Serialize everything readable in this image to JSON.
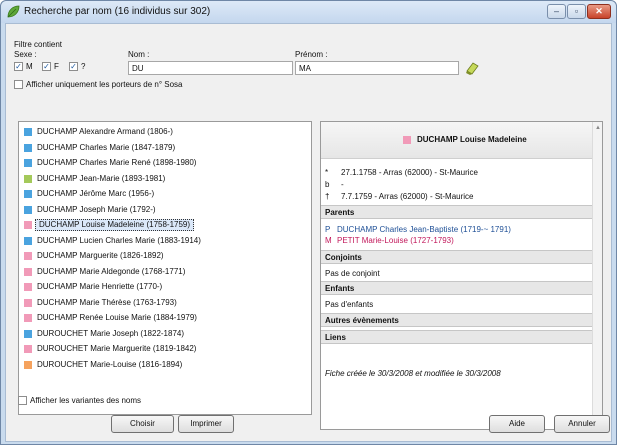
{
  "window": {
    "title": "Recherche par nom (16 individus sur 302)",
    "buttons": {
      "minimize": "‒",
      "maximize": "▫",
      "close": "✕"
    }
  },
  "filter": {
    "group_label": "Filtre contient",
    "sex_label": "Sexe :",
    "sex_options": [
      {
        "label": "M",
        "checked": true
      },
      {
        "label": "F",
        "checked": true
      },
      {
        "label": "?",
        "checked": true
      }
    ],
    "nom_label": "Nom :",
    "nom_value": "DU",
    "prenom_label": "Prénom :",
    "prenom_value": "MA",
    "sosa_label": "Afficher uniquement les porteurs de n° Sosa",
    "sosa_checked": false,
    "clear_icon": "eraser-icon"
  },
  "list": {
    "items": [
      {
        "label": "DUCHAMP Alexandre Armand (1806-)",
        "color": "#4aa3df"
      },
      {
        "label": "DUCHAMP Charles Marie (1847-1879)",
        "color": "#4aa3df"
      },
      {
        "label": "DUCHAMP Charles Marie René (1898-1980)",
        "color": "#4aa3df"
      },
      {
        "label": "DUCHAMP Jean-Marie (1893-1981)",
        "color": "#a4c95a"
      },
      {
        "label": "DUCHAMP Jérôme Marc (1956-)",
        "color": "#4aa3df"
      },
      {
        "label": "DUCHAMP Joseph Marie (1792-)",
        "color": "#4aa3df"
      },
      {
        "label": "DUCHAMP Louise Madeleine (1758-1759)",
        "color": "#f19ab8",
        "selected": true
      },
      {
        "label": "DUCHAMP Lucien Charles Marie (1883-1914)",
        "color": "#4aa3df"
      },
      {
        "label": "DUCHAMP Marguerite (1826-1892)",
        "color": "#f19ab8"
      },
      {
        "label": "DUCHAMP Marie Aldegonde (1768-1771)",
        "color": "#f19ab8"
      },
      {
        "label": "DUCHAMP Marie Henriette (1770-)",
        "color": "#f19ab8"
      },
      {
        "label": "DUCHAMP Marie Thérèse (1763-1793)",
        "color": "#f19ab8"
      },
      {
        "label": "DUCHAMP Renée Louise Marie (1884-1979)",
        "color": "#f19ab8"
      },
      {
        "label": "DUROUCHET Marie Joseph (1822-1874)",
        "color": "#4aa3df"
      },
      {
        "label": "DUROUCHET Marie Marguerite (1819-1842)",
        "color": "#f19ab8"
      },
      {
        "label": "DUROUCHET Marie-Louise (1816-1894)",
        "color": "#f5a25d"
      }
    ],
    "variants_label": "Afficher les variantes des noms",
    "variants_checked": false
  },
  "detail": {
    "name": "DUCHAMP Louise Madeleine",
    "birth_symbol": "*",
    "birth": "27.1.1758 - Arras (62000) - St-Maurice",
    "baptism_symbol": "b",
    "baptism": "-",
    "death_symbol": "†",
    "death": "7.7.1759 - Arras (62000) - St-Maurice",
    "parents_title": "Parents",
    "father_prefix": "P",
    "father": "DUCHAMP Charles Jean-Baptiste (1719-~ 1791)",
    "mother_prefix": "M",
    "mother": "PETIT Marie-Louise (1727-1793)",
    "spouses_title": "Conjoints",
    "spouses_text": "Pas de conjoint",
    "children_title": "Enfants",
    "children_text": "Pas d'enfants",
    "events_title": "Autres évènements",
    "links_title": "Liens",
    "footer": "Fiche créée le 30/3/2008 et modifiée le 30/3/2008"
  },
  "buttons": {
    "choose": "Choisir",
    "print": "Imprimer",
    "help": "Aide",
    "cancel": "Annuler"
  }
}
